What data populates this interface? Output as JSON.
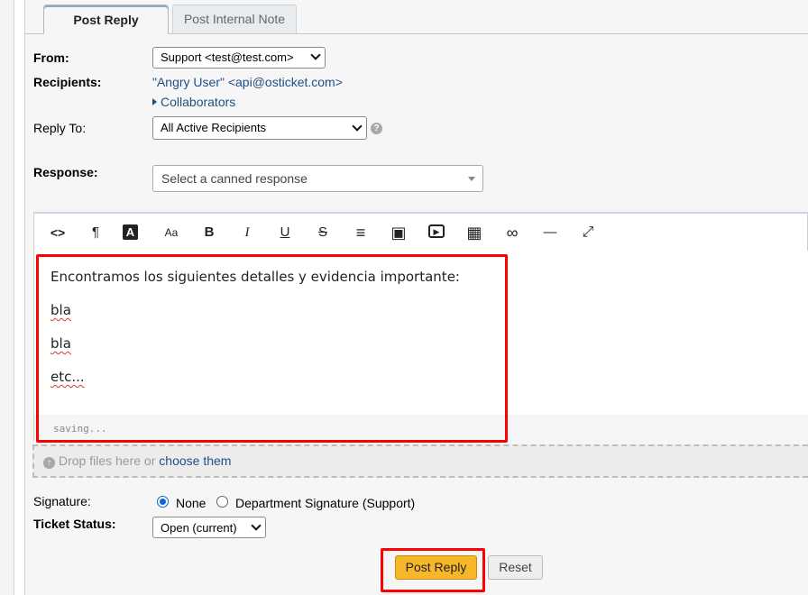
{
  "tabs": [
    {
      "label": "Post Reply",
      "active": true
    },
    {
      "label": "Post Internal Note",
      "active": false
    }
  ],
  "form": {
    "from_label": "From:",
    "from_value": "Support <test@test.com>",
    "recipients_label": "Recipients:",
    "recipient": "\"Angry User\" <api@osticket.com>",
    "collaborators_link": "Collaborators",
    "reply_to_label": "Reply To:",
    "reply_to_value": "All Active Recipients",
    "help_icon_glyph": "?",
    "response_label": "Response:",
    "canned_placeholder": "Select a canned response"
  },
  "toolbar": {
    "buttons": [
      {
        "name": "html-icon",
        "glyph": "<>"
      },
      {
        "name": "paragraph-icon",
        "glyph": "¶"
      },
      {
        "name": "font-color-icon",
        "glyph": "A"
      },
      {
        "name": "font-size-icon",
        "glyph": "Aa"
      },
      {
        "name": "bold-icon",
        "glyph": "B"
      },
      {
        "name": "italic-icon",
        "glyph": "I"
      },
      {
        "name": "underline-icon",
        "glyph": "U"
      },
      {
        "name": "strikethrough-icon",
        "glyph": "S"
      },
      {
        "name": "list-icon",
        "glyph": "≡"
      },
      {
        "name": "image-icon",
        "glyph": "▣"
      },
      {
        "name": "video-icon",
        "glyph": "▶"
      },
      {
        "name": "table-icon",
        "glyph": "▦"
      },
      {
        "name": "link-icon",
        "glyph": "∞"
      },
      {
        "name": "horizontal-rule-icon",
        "glyph": "—"
      },
      {
        "name": "fullscreen-icon",
        "glyph": "⤢"
      }
    ]
  },
  "editor": {
    "paragraphs": [
      "Encontramos los siguientes detalles y evidencia importante:",
      "bla",
      "bla",
      "etc..."
    ],
    "status": "saving..."
  },
  "attachments": {
    "drop_text": "Drop files here or ",
    "choose_link": "choose them"
  },
  "signature": {
    "label": "Signature:",
    "options": [
      {
        "label": "None",
        "selected": true
      },
      {
        "label": "Department Signature (Support)",
        "selected": false
      }
    ]
  },
  "ticket_status": {
    "label": "Ticket Status:",
    "value": "Open (current)"
  },
  "actions": {
    "post_reply": "Post Reply",
    "reset": "Reset"
  },
  "colors": {
    "highlight": "#ff0000",
    "primary_button": "#f8b72b",
    "link": "#1e4f85",
    "radio_selected": "#0a66d6"
  }
}
